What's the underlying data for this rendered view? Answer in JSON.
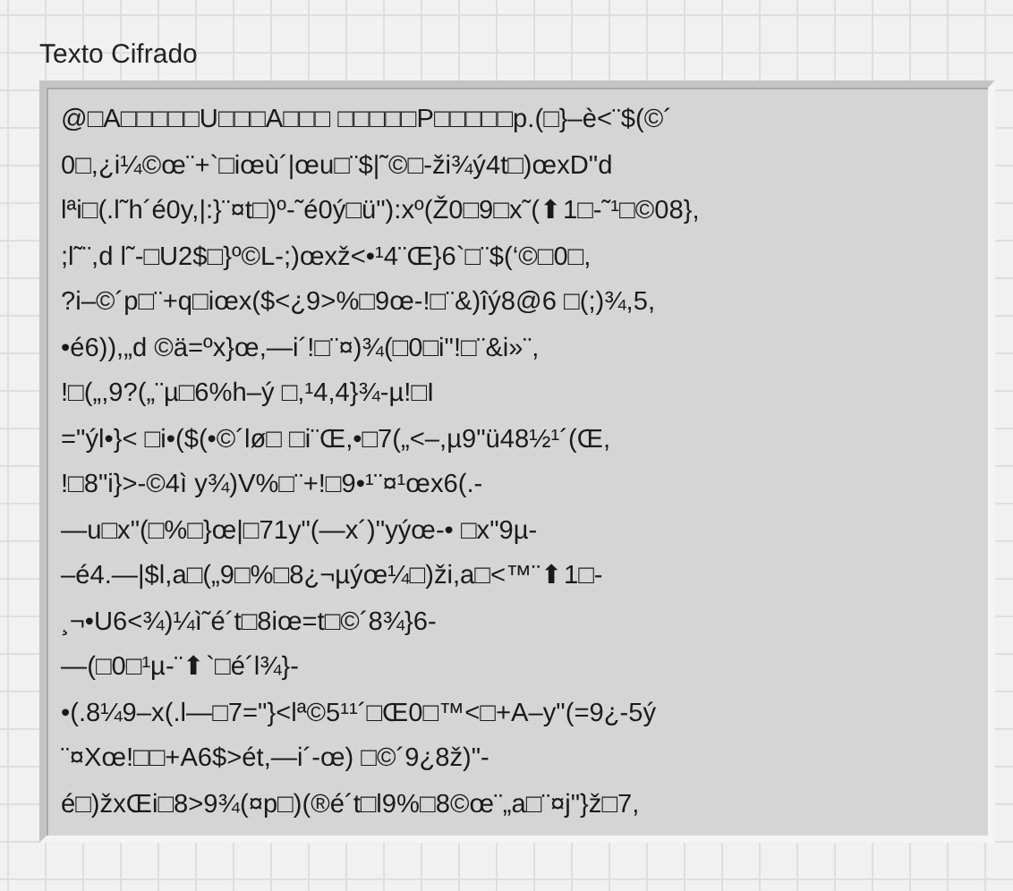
{
  "text_indicator": {
    "label": "Texto Cifrado",
    "lines": [
      "@□A□□□□□U□□□A□□□ □□□□□P□□□□□p.(□}–è<¨$(©´",
      "0□,¿i¼©œ¨+`□iœù´|œu□¨$|˜©□-ži¾ý4t□)œxD\"d",
      "lªi□(.l˜h´é0y,|:}¨¤t□)º-˜é0ý□ü\"):xº(Ž0□9□x˜(⬆1□-˜¹□©08},",
      ";l˜¨,d l˜-□U2$□}º©L-;)œxž<•¹4¨Œ}6`□¨$(‘©□0□,",
      "?i–©´p□¨+q□iœx($<¿9>%□9œ-!□¨&)îý8@6 □(;)¾,5,",
      "•é6)),„d ©ä=ºx}œ,—i´!□¨¤)¾(□0□i\"!□¨&i»¨,",
      "!□(„,9?(„¨µ□6%h–ý □,¹4,4}¾-µ!□I",
      "=\"ýl•}< □i•($(•©´lø□ □i¨Œ,•□7(„<–,µ9\"ü48½¹´(Œ,",
      "!□8\"i}>-©4ì y¾)V%□¨+!□9•¹¨¤¹œx6(.-",
      "—u□x\"(□%□}œ|□71y\"(—x´)\"yýœ-• □x\"9µ-",
      "–é4.—|$l,a□(„9□%□8¿¬µýœ¼□)ži,a□<™¨⬆1□-",
      "¸¬•U6<¾)¼ì˜é´t□8iœ=t□©´8¾}6-",
      "—(□0□¹µ-¨⬆`□é´l¾}-",
      "•(.8¼9–x(.l—□7=\"}<lª©5¹¹´□Œ0□™<□+A–y\"(=9¿-5ý",
      "¨¤Xœ!□□+A6$>ét,—i´-œ) □©´9¿8ž)\"-",
      "é□)žxŒi□8>9¾(¤p□)(®é´t□l9%□8©œ¨„a□¨¤j\"}ž□7,"
    ]
  }
}
